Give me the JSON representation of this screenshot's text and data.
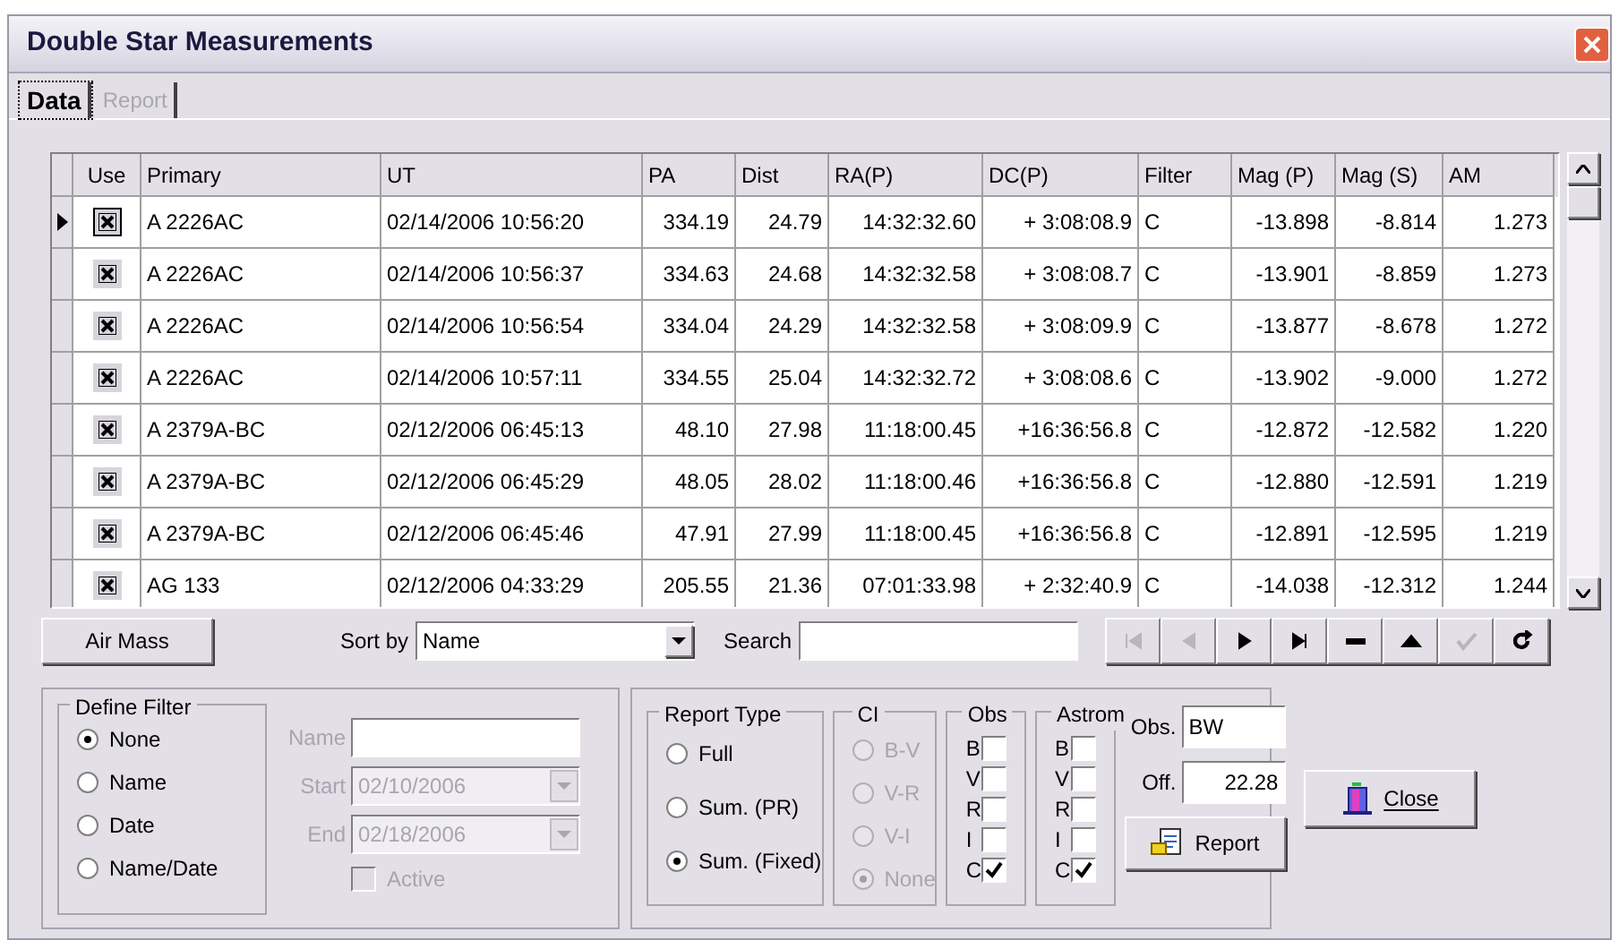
{
  "window": {
    "title": "Double Star Measurements"
  },
  "tabs": [
    {
      "label": "Data",
      "selected": true
    },
    {
      "label": "Report",
      "selected": false
    }
  ],
  "table": {
    "use_column": "Use",
    "columns": [
      "Primary",
      "UT",
      "PA",
      "Dist",
      "RA(P)",
      "DC(P)",
      "Filter",
      "Mag (P)",
      "Mag (S)",
      "AM"
    ],
    "rows": [
      {
        "selected": true,
        "use": true,
        "cells": [
          "A 2226AC",
          "02/14/2006 10:56:20",
          "334.19",
          "24.79",
          "14:32:32.60",
          "+ 3:08:08.9",
          "C",
          "-13.898",
          "-8.814",
          "1.273"
        ]
      },
      {
        "selected": false,
        "use": true,
        "cells": [
          "A 2226AC",
          "02/14/2006 10:56:37",
          "334.63",
          "24.68",
          "14:32:32.58",
          "+ 3:08:08.7",
          "C",
          "-13.901",
          "-8.859",
          "1.273"
        ]
      },
      {
        "selected": false,
        "use": true,
        "cells": [
          "A 2226AC",
          "02/14/2006 10:56:54",
          "334.04",
          "24.29",
          "14:32:32.58",
          "+ 3:08:09.9",
          "C",
          "-13.877",
          "-8.678",
          "1.272"
        ]
      },
      {
        "selected": false,
        "use": true,
        "cells": [
          "A 2226AC",
          "02/14/2006 10:57:11",
          "334.55",
          "25.04",
          "14:32:32.72",
          "+ 3:08:08.6",
          "C",
          "-13.902",
          "-9.000",
          "1.272"
        ]
      },
      {
        "selected": false,
        "use": true,
        "cells": [
          "A 2379A-BC",
          "02/12/2006 06:45:13",
          "48.10",
          "27.98",
          "11:18:00.45",
          "+16:36:56.8",
          "C",
          "-12.872",
          "-12.582",
          "1.220"
        ]
      },
      {
        "selected": false,
        "use": true,
        "cells": [
          "A 2379A-BC",
          "02/12/2006 06:45:29",
          "48.05",
          "28.02",
          "11:18:00.46",
          "+16:36:56.8",
          "C",
          "-12.880",
          "-12.591",
          "1.219"
        ]
      },
      {
        "selected": false,
        "use": true,
        "cells": [
          "A 2379A-BC",
          "02/12/2006 06:45:46",
          "47.91",
          "27.99",
          "11:18:00.45",
          "+16:36:56.8",
          "C",
          "-12.891",
          "-12.595",
          "1.219"
        ]
      },
      {
        "selected": false,
        "use": true,
        "cells": [
          "AG 133",
          "02/12/2006 04:33:29",
          "205.55",
          "21.36",
          "07:01:33.98",
          "+ 2:32:40.9",
          "C",
          "-14.038",
          "-12.312",
          "1.244"
        ]
      }
    ]
  },
  "air_mass_button": "Air Mass",
  "sort_by": {
    "label": "Sort by",
    "value": "Name"
  },
  "search": {
    "label": "Search"
  },
  "navigator": [
    {
      "kind": "first",
      "disabled": true
    },
    {
      "kind": "prior",
      "disabled": true
    },
    {
      "kind": "next",
      "disabled": false
    },
    {
      "kind": "last",
      "disabled": false
    },
    {
      "kind": "delete",
      "disabled": false
    },
    {
      "kind": "edit",
      "disabled": false
    },
    {
      "kind": "post",
      "disabled": true
    },
    {
      "kind": "refresh",
      "disabled": false
    }
  ],
  "define_filter": {
    "title": "Define Filter",
    "options": [
      {
        "label": "None",
        "selected": true
      },
      {
        "label": "Name",
        "selected": false
      },
      {
        "label": "Date",
        "selected": false
      },
      {
        "label": "Name/Date",
        "selected": false
      }
    ],
    "name_label": "Name",
    "start_label": "Start",
    "start_value": "02/10/2006",
    "end_label": "End",
    "end_value": "02/18/2006",
    "active": {
      "label": "Active",
      "checked": false,
      "disabled": true
    }
  },
  "report_type": {
    "title": "Report Type",
    "options": [
      {
        "label": "Full",
        "selected": false
      },
      {
        "label": "Sum. (PR)",
        "selected": false
      },
      {
        "label": "Sum. (Fixed)",
        "selected": true
      }
    ]
  },
  "ci": {
    "title": "CI",
    "disabled": true,
    "options": [
      {
        "label": "B-V",
        "selected": false
      },
      {
        "label": "V-R",
        "selected": false
      },
      {
        "label": "V-I",
        "selected": false
      },
      {
        "label": "None",
        "selected": true
      }
    ]
  },
  "obs": {
    "title": "Obs",
    "items": [
      {
        "label": "B",
        "checked": false
      },
      {
        "label": "V",
        "checked": false
      },
      {
        "label": "R",
        "checked": false
      },
      {
        "label": "I",
        "checked": false
      },
      {
        "label": "C",
        "checked": true
      }
    ]
  },
  "astrom": {
    "title": "Astrom",
    "items": [
      {
        "label": "B",
        "checked": false
      },
      {
        "label": "V",
        "checked": false
      },
      {
        "label": "R",
        "checked": false
      },
      {
        "label": "I",
        "checked": false
      },
      {
        "label": "C",
        "checked": true
      }
    ]
  },
  "observer": {
    "label": "Obs.",
    "value": "BW"
  },
  "offset": {
    "label": "Off.",
    "value": "22.28"
  },
  "report_button": "Report",
  "close_button": "Close"
}
